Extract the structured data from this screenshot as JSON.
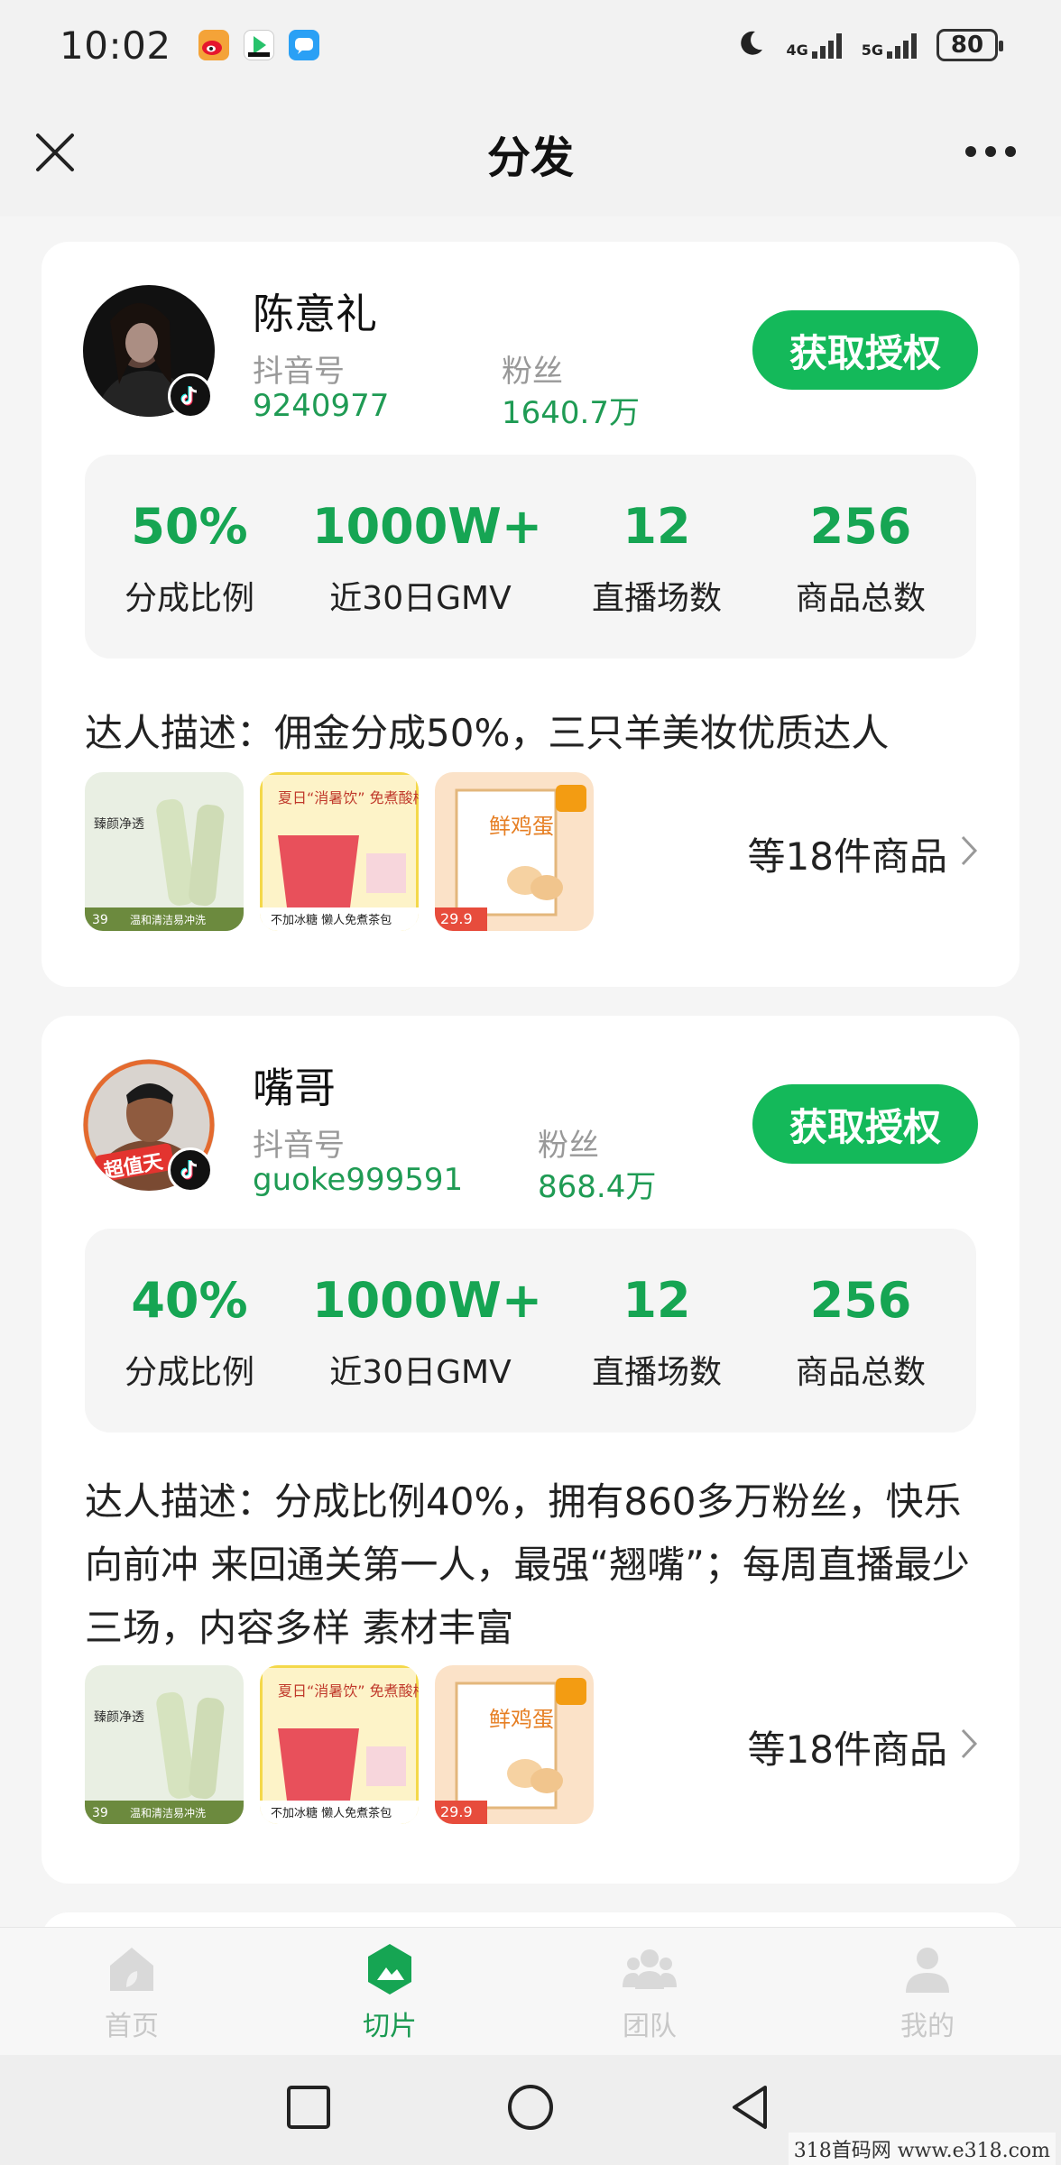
{
  "status_bar": {
    "time": "10:02",
    "network_1": "4G",
    "network_2": "5G",
    "battery": "80",
    "icons": [
      "weibo-icon",
      "video-app-icon",
      "message-app-icon",
      "moon-icon"
    ]
  },
  "navbar": {
    "title": "分发",
    "close_icon": "close-icon",
    "more_icon": "more-icon"
  },
  "creators": [
    {
      "name": "陈意礼",
      "douyin_label": "抖音号",
      "douyin_id": "9240977",
      "fans_label": "粉丝",
      "fans": "1640.7万",
      "button_label": "获取授权",
      "stats": [
        {
          "value": "50%",
          "label": "分成比例"
        },
        {
          "value": "1000W+",
          "label": "近30日GMV"
        },
        {
          "value": "12",
          "label": "直播场数"
        },
        {
          "value": "256",
          "label": "商品总数"
        }
      ],
      "description": "达人描述：佣金分成50%，三只羊美妆优质达人",
      "products": [
        {
          "price": "39",
          "caption": "温和清洁易冲洗",
          "title": "臻颜净透"
        },
        {
          "price": "",
          "caption": "不加冰糖 懒人免煮茶包",
          "title": "夏日“消暑饮” 免煮酸梅汤"
        },
        {
          "price": "29.9",
          "caption": "",
          "title": "鲜鸡蛋"
        }
      ],
      "more_products": "等18件商品"
    },
    {
      "name": "嘴哥",
      "douyin_label": "抖音号",
      "douyin_id": "guoke999591",
      "fans_label": "粉丝",
      "fans": "868.4万",
      "button_label": "获取授权",
      "stats": [
        {
          "value": "40%",
          "label": "分成比例"
        },
        {
          "value": "1000W+",
          "label": "近30日GMV"
        },
        {
          "value": "12",
          "label": "直播场数"
        },
        {
          "value": "256",
          "label": "商品总数"
        }
      ],
      "description": "达人描述：分成比例40%，拥有860多万粉丝，快乐向前冲 来回通关第一人，最强“翘嘴”；每周直播最少三场，内容多样 素材丰富",
      "products": [
        {
          "price": "39",
          "caption": "温和清洁易冲洗",
          "title": "臻颜净透"
        },
        {
          "price": "",
          "caption": "不加冰糖 懒人免煮茶包",
          "title": "夏日“消暑饮” 免煮酸梅汤"
        },
        {
          "price": "29.9",
          "caption": "",
          "title": "鲜鸡蛋"
        }
      ],
      "more_products": "等18件商品"
    }
  ],
  "tabbar": [
    {
      "label": "首页",
      "icon": "home-icon",
      "active": false
    },
    {
      "label": "切片",
      "icon": "clips-icon",
      "active": true
    },
    {
      "label": "团队",
      "icon": "team-icon",
      "active": false
    },
    {
      "label": "我的",
      "icon": "profile-icon",
      "active": false
    }
  ],
  "watermark": "318首码网 www.e318.com",
  "colors": {
    "accent_green": "#14b95a",
    "stat_green": "#16a553",
    "background": "#f5f5f5"
  }
}
